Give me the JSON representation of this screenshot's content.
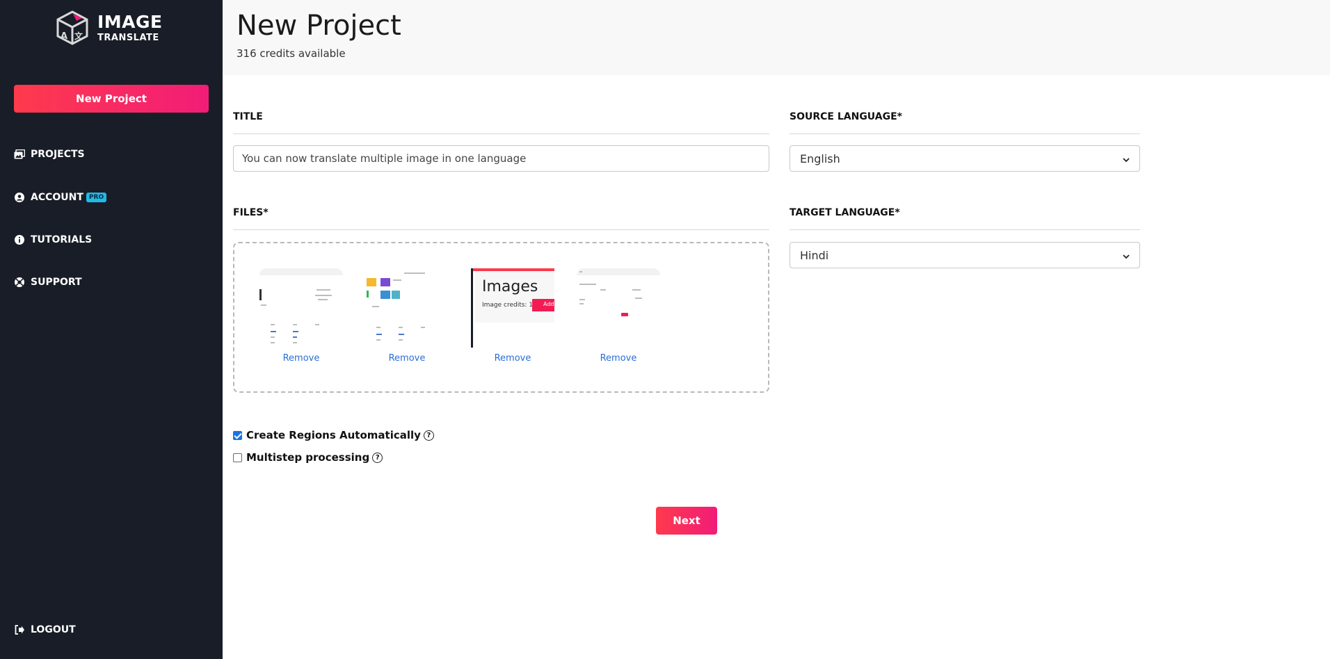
{
  "brand": {
    "line1": "IMAGE",
    "line2": "TRANSLATE"
  },
  "sidebar": {
    "new_project_label": "New Project",
    "items": [
      {
        "label": "PROJECTS",
        "icon": "images-icon"
      },
      {
        "label": "ACCOUNT",
        "icon": "user-circle-icon",
        "badge": "PRO"
      },
      {
        "label": "TUTORIALS",
        "icon": "info-circle-icon"
      },
      {
        "label": "SUPPORT",
        "icon": "lifebuoy-icon"
      }
    ],
    "logout_label": "LOGOUT"
  },
  "header": {
    "title": "New Project",
    "credits": "316 credits available"
  },
  "form": {
    "title_label": "TITLE",
    "title_value": "You can now translate multiple image in one language",
    "source_label": "SOURCE LANGUAGE*",
    "source_value": "English",
    "files_label": "FILES*",
    "target_label": "TARGET LANGUAGE*",
    "target_value": "Hindi",
    "files": [
      {
        "remove_label": "Remove"
      },
      {
        "remove_label": "Remove"
      },
      {
        "remove_label": "Remove",
        "preview_title": "Images",
        "preview_sub": "Image credits: 1",
        "preview_btn": "Add"
      },
      {
        "remove_label": "Remove"
      }
    ],
    "create_regions_label": "Create Regions Automatically",
    "create_regions_checked": true,
    "multistep_label": "Multistep processing",
    "multistep_checked": false,
    "next_label": "Next"
  },
  "colors": {
    "sidebar_bg": "#181d27",
    "accent_start": "#fe3a4c",
    "accent_end": "#f21c78",
    "link": "#2b6ed8",
    "pro_badge": "#21b9e8"
  }
}
